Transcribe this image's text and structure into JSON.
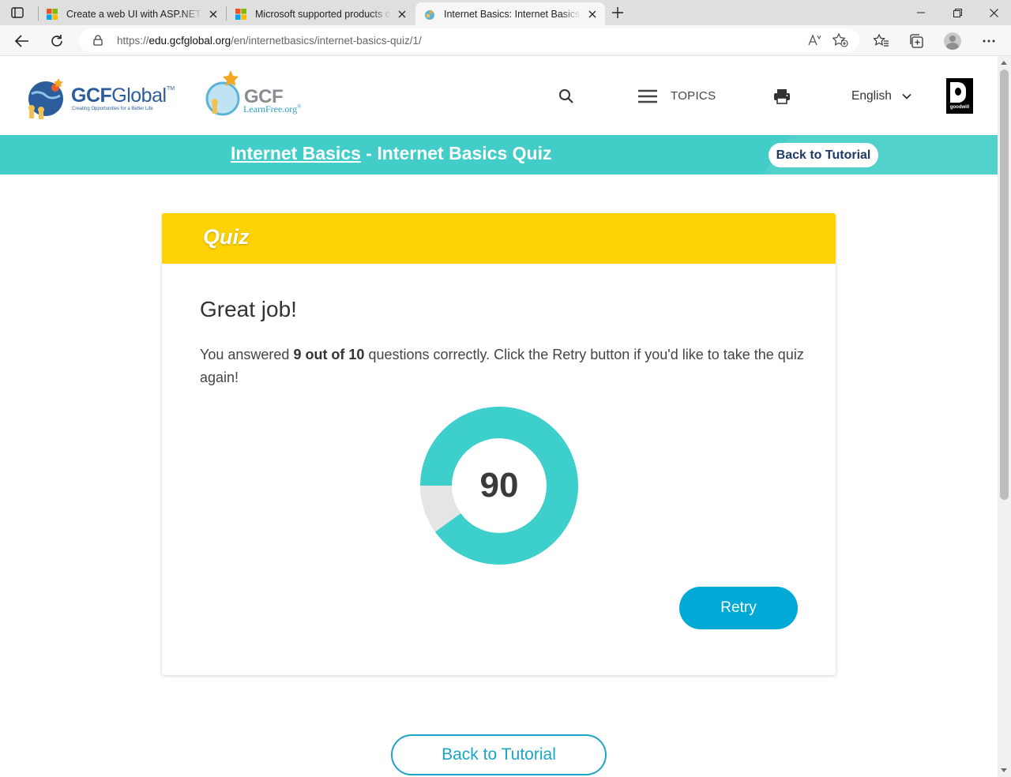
{
  "browser": {
    "tabs": [
      {
        "title": "Create a web UI with ASP.NET Co",
        "active": false
      },
      {
        "title": "Microsoft supported products or",
        "active": false
      },
      {
        "title": "Internet Basics: Internet Basics Q",
        "active": true
      }
    ],
    "url": {
      "prefix": "https://",
      "domain": "edu.gcfglobal.org",
      "path": "/en/internetbasics/internet-basics-quiz/1/"
    }
  },
  "header": {
    "logo_main": "GCF",
    "logo_main_thin": "Global",
    "logo_tm": "TM",
    "logo_tagline": "Creating Opportunities for a Better Life",
    "logo2_word": "GCF",
    "logo2_sub": "LearnFree.org",
    "logo2_reg": "®",
    "topics_label": "TOPICS",
    "language": "English",
    "goodwill_text": "goodwill"
  },
  "banner": {
    "course_link": "Internet Basics",
    "separator": " - ",
    "page_title": "Internet Basics Quiz",
    "back_button": "Back to Tutorial",
    "color": "#43cdc8"
  },
  "quiz": {
    "header": "Quiz",
    "heading": "Great job!",
    "result_prefix": "You answered ",
    "result_bold": "9 out of 10",
    "result_suffix": " questions correctly. Click the Retry button if you'd like to take the quiz again!",
    "score": "90",
    "score_fraction": 0.9,
    "retry_label": "Retry",
    "colors": {
      "accent": "#fed203",
      "donut": "#3ccfcb",
      "donut_bg": "#e5e5e5",
      "button": "#00a9d6"
    }
  },
  "footer": {
    "back_button": "Back to Tutorial"
  }
}
